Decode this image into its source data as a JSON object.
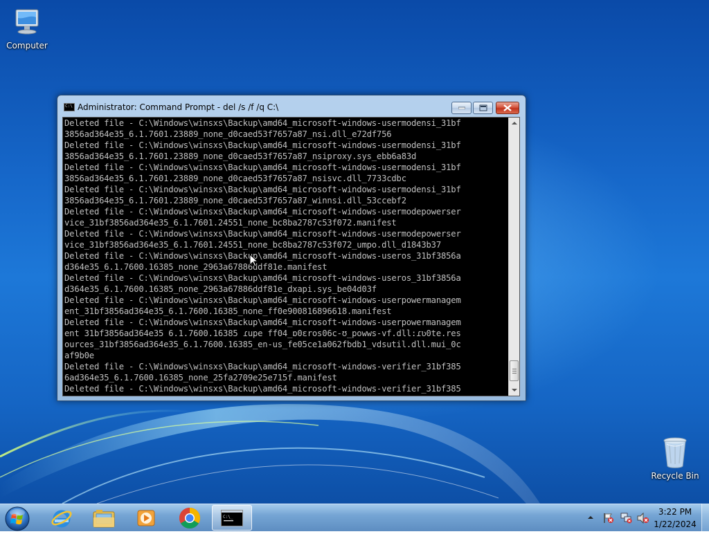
{
  "desktop": {
    "icons": [
      {
        "label": "Computer"
      },
      {
        "label": "Recycle Bin"
      }
    ]
  },
  "window": {
    "title": "Administrator:  Command Prompt - del  /s /f /q C:\\",
    "console_lines": [
      "Deleted file - C:\\Windows\\winsxs\\Backup\\amd64_microsoft-windows-usermodensi_31bf",
      "3856ad364e35_6.1.7601.23889_none_d0caed53f7657a87_nsi.dll_e72df756",
      "Deleted file - C:\\Windows\\winsxs\\Backup\\amd64_microsoft-windows-usermodensi_31bf",
      "3856ad364e35_6.1.7601.23889_none_d0caed53f7657a87_nsiproxy.sys_ebb6a83d",
      "Deleted file - C:\\Windows\\winsxs\\Backup\\amd64_microsoft-windows-usermodensi_31bf",
      "3856ad364e35_6.1.7601.23889_none_d0caed53f7657a87_nsisvc.dll_7733cdbc",
      "Deleted file - C:\\Windows\\winsxs\\Backup\\amd64_microsoft-windows-usermodensi_31bf",
      "3856ad364e35_6.1.7601.23889_none_d0caed53f7657a87_winnsi.dll_53ccebf2",
      "Deleted file - C:\\Windows\\winsxs\\Backup\\amd64_microsoft-windows-usermodepowerser",
      "vice_31bf3856ad364e35_6.1.7601.24551_none_bc8ba2787c53f072.manifest",
      "Deleted file - C:\\Windows\\winsxs\\Backup\\amd64_microsoft-windows-usermodepowerser",
      "vice_31bf3856ad364e35_6.1.7601.24551_none_bc8ba2787c53f072_umpo.dll_d1843b37",
      "Deleted file - C:\\Windows\\winsxs\\Backup\\amd64_microsoft-windows-useros_31bf3856a",
      "d364e35_6.1.7600.16385_none_2963a67886ddf81e.manifest",
      "Deleted file - C:\\Windows\\winsxs\\Backup\\amd64_microsoft-windows-useros_31bf3856a",
      "d364e35_6.1.7600.16385_none_2963a67886ddf81e_dxapi.sys_be04d03f",
      "Deleted file - C:\\Windows\\winsxs\\Backup\\amd64_microsoft-windows-userpowermanagem",
      "ent_31bf3856ad364e35_6.1.7600.16385_none_ff0e900816896618.manifest",
      "Deleted file - C:\\Windows\\winsxs\\Backup\\amd64_microsoft-windows-userpowermanagem",
      "ent 31bf3856ad364e35 6.1.7600.16385 ɾupe ff04_ɒ0ɛros06c-ʊ_powws-vf.dll:ɾʋ0te.res",
      "ources_31bf3856ad364e35_6.1.7600.16385_en-us_fe05ce1a062fbdb1_vdsutil.dll.mui_0c",
      "af9b0e",
      "Deleted file - C:\\Windows\\winsxs\\Backup\\amd64_microsoft-windows-verifier_31bf385",
      "6ad364e35_6.1.7600.16385_none_25fa2709e25e715f.manifest",
      "Deleted file - C:\\Windows\\winsxs\\Backup\\amd64_microsoft-windows-verifier_31bf385"
    ]
  },
  "tray": {
    "time": "3:22 PM",
    "date": "1/22/2024"
  }
}
